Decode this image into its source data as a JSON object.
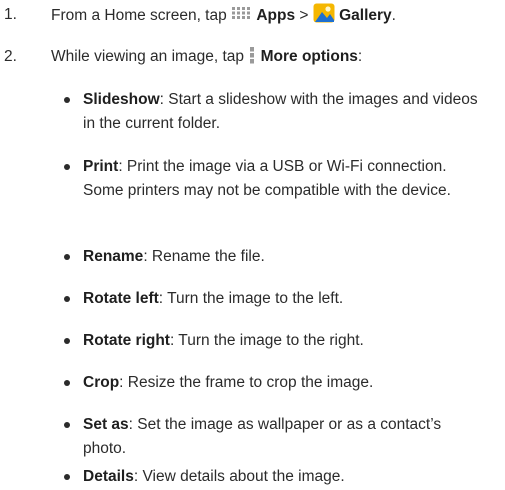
{
  "steps": [
    {
      "number": "1.",
      "pre": "From a Home screen, tap ",
      "apps_label": "Apps",
      "sep": " > ",
      "gallery_label": "Gallery",
      "end": "."
    },
    {
      "number": "2.",
      "pre": "While viewing an image, tap ",
      "more_label": "More options",
      "end": ":"
    }
  ],
  "options": [
    {
      "term": "Slideshow",
      "desc": ": Start a slideshow with the images and videos in the current folder."
    },
    {
      "term": "Print",
      "desc": ": Print the image via a USB or Wi-Fi connection. Some printers may not be compatible with the device."
    },
    {
      "term": "Rename",
      "desc": ": Rename the file."
    },
    {
      "term": "Rotate left",
      "desc": ": Turn the image to the left."
    },
    {
      "term": "Rotate right",
      "desc": ": Turn the image to the right."
    },
    {
      "term": "Crop",
      "desc": ": Resize the frame to crop the image."
    },
    {
      "term": "Set as",
      "desc": ": Set the image as wallpaper or as a contact’s photo."
    },
    {
      "term": "Details",
      "desc": ": View details about the image."
    }
  ],
  "icons": {
    "apps": "apps-grid-icon",
    "gallery": "gallery-icon",
    "more": "more-options-icon"
  },
  "colors": {
    "text": "#2b2b2b",
    "icon_gray": "#9a9a9a",
    "gallery_yellow": "#f5b700",
    "gallery_blue": "#1e6fd0"
  }
}
